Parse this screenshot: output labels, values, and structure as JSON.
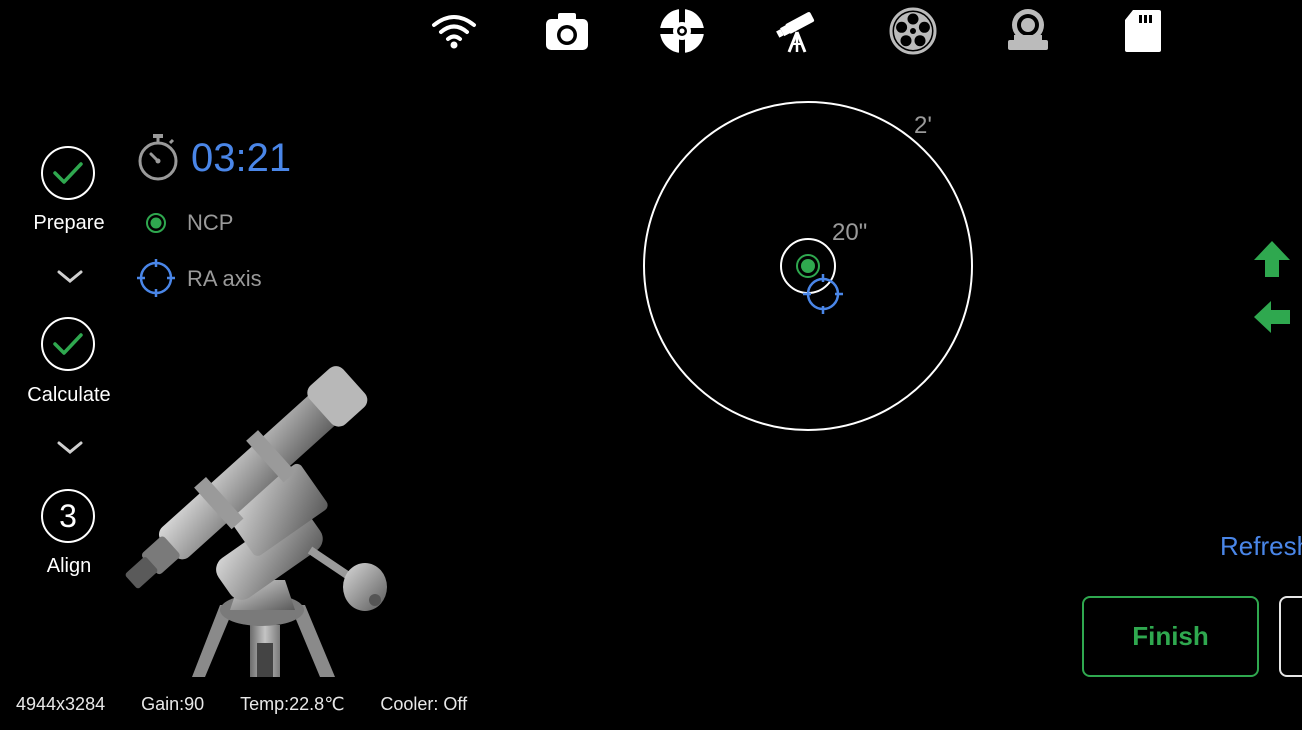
{
  "toolbar": {
    "items": [
      {
        "icon": "wifi-icon"
      },
      {
        "icon": "camera-icon"
      },
      {
        "icon": "crosshair-icon"
      },
      {
        "icon": "telescope-icon"
      },
      {
        "icon": "filter-wheel-icon"
      },
      {
        "icon": "focuser-icon"
      },
      {
        "icon": "sd-card-icon"
      }
    ]
  },
  "steps": [
    {
      "label": "Prepare",
      "state": "done"
    },
    {
      "label": "Calculate",
      "state": "done"
    },
    {
      "label": "Align",
      "state": "current",
      "number": "3"
    }
  ],
  "info": {
    "timer": "03:21",
    "legend_ncp": "NCP",
    "legend_ra": "RA axis"
  },
  "target": {
    "outer_label": "2'",
    "inner_label": "20\""
  },
  "actions": {
    "refresh": "Refresh",
    "finish": "Finish"
  },
  "status": {
    "resolution": "4944x3284",
    "gain": "Gain:90",
    "temp": "Temp:22.8℃",
    "cooler": "Cooler: Off"
  },
  "colors": {
    "accent_blue": "#4a86e8",
    "accent_green": "#2fa84f",
    "muted_text": "#9a9a9a"
  }
}
